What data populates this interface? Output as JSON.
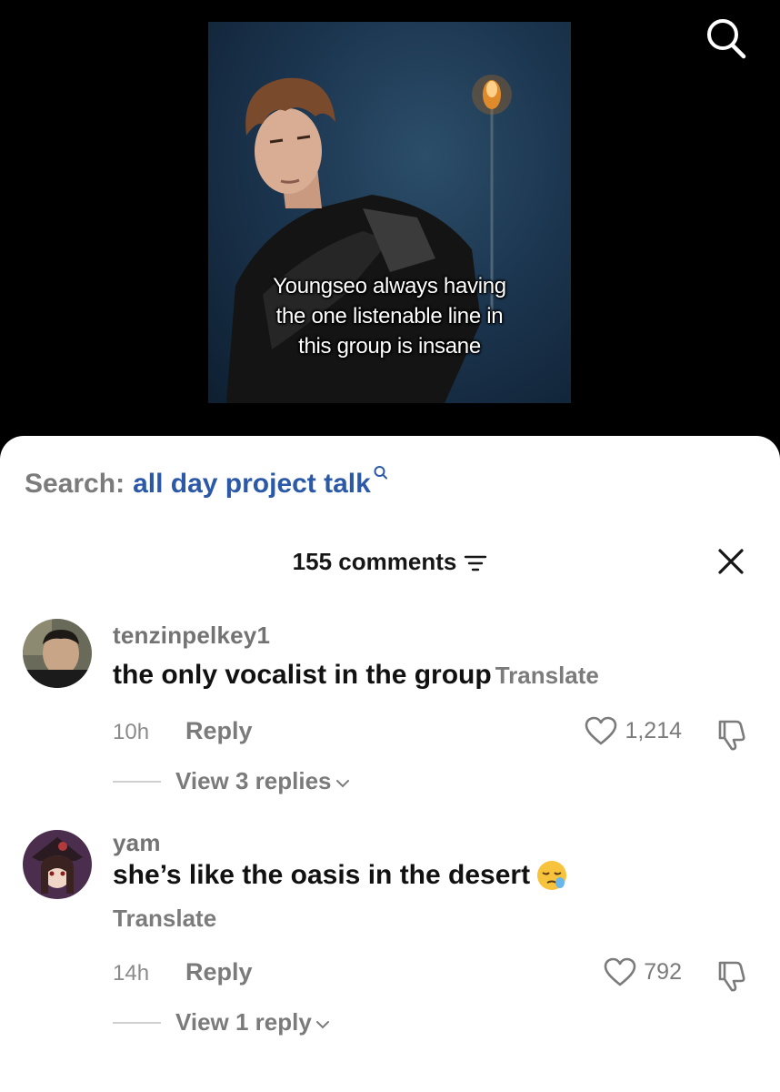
{
  "video": {
    "caption_lines": [
      "Youngseo always having",
      "the one listenable line in",
      "this group is insane"
    ]
  },
  "top_bar": {
    "search_icon": "search-icon"
  },
  "sheet": {
    "search_label": "Search:",
    "search_term": "all day project talk",
    "comment_count": "155 comments",
    "sort_icon": "sort-icon",
    "close_icon": "close-icon"
  },
  "comments": [
    {
      "username": "tenzinpelkey1",
      "text": "the only vocalist in the group",
      "translate": "Translate",
      "time": "10h",
      "reply": "Reply",
      "likes": "1,214",
      "view_replies": "View 3 replies"
    },
    {
      "username": "yam",
      "text": "she’s like the oasis in the desert",
      "emoji": "sleepy-face-emoji",
      "translate": "Translate",
      "time": "14h",
      "reply": "Reply",
      "likes": "792",
      "view_replies": "View 1 reply"
    }
  ],
  "colors": {
    "accent_link": "#2b59a8",
    "muted_text": "#7b7b7b",
    "background_top": "#000000",
    "sheet_background": "#ffffff"
  }
}
